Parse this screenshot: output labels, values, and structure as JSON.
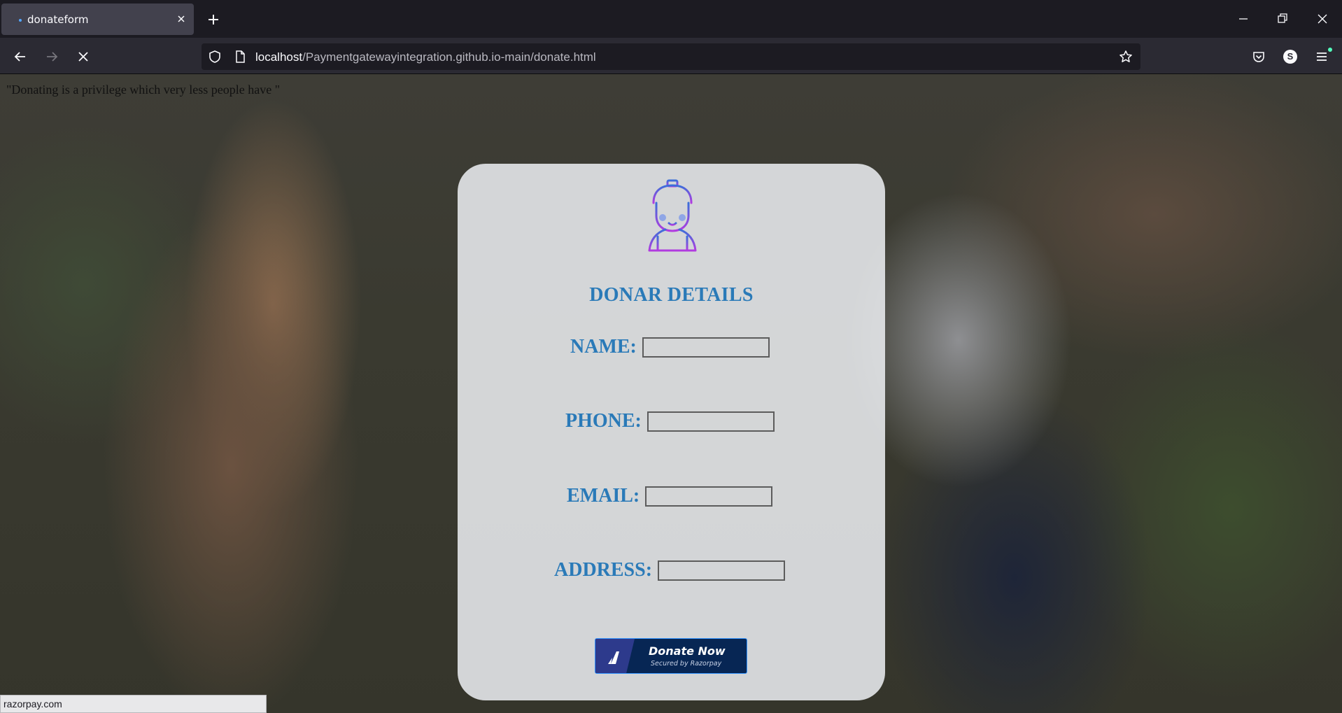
{
  "browser": {
    "tab": {
      "title": "donateform"
    },
    "url": {
      "host": "localhost",
      "path": "/Paymentgatewayintegration.github.io-main/donate.html"
    },
    "avatar_letter": "S",
    "status_text": "razorpay.com",
    "colors": {
      "tabstrip": "#1c1b22",
      "toolbar": "#2b2a33",
      "accent": "#54a6ff"
    }
  },
  "page": {
    "quote": "\"Donating is a privilege which very less people have \"",
    "form": {
      "icon": "donor-person-icon",
      "title": "DONAR DETAILS",
      "fields": [
        {
          "label": "NAME:",
          "value": ""
        },
        {
          "label": "PHONE:",
          "value": ""
        },
        {
          "label": "EMAIL:",
          "value": ""
        },
        {
          "label": "ADDRESS:",
          "value": ""
        }
      ],
      "donate_button": {
        "label": "Donate Now",
        "sub_label": "Secured by Razorpay"
      }
    },
    "colors": {
      "heading": "#2a7ab8",
      "button_bg": "#072654",
      "card_bg": "#eef0f3"
    }
  }
}
